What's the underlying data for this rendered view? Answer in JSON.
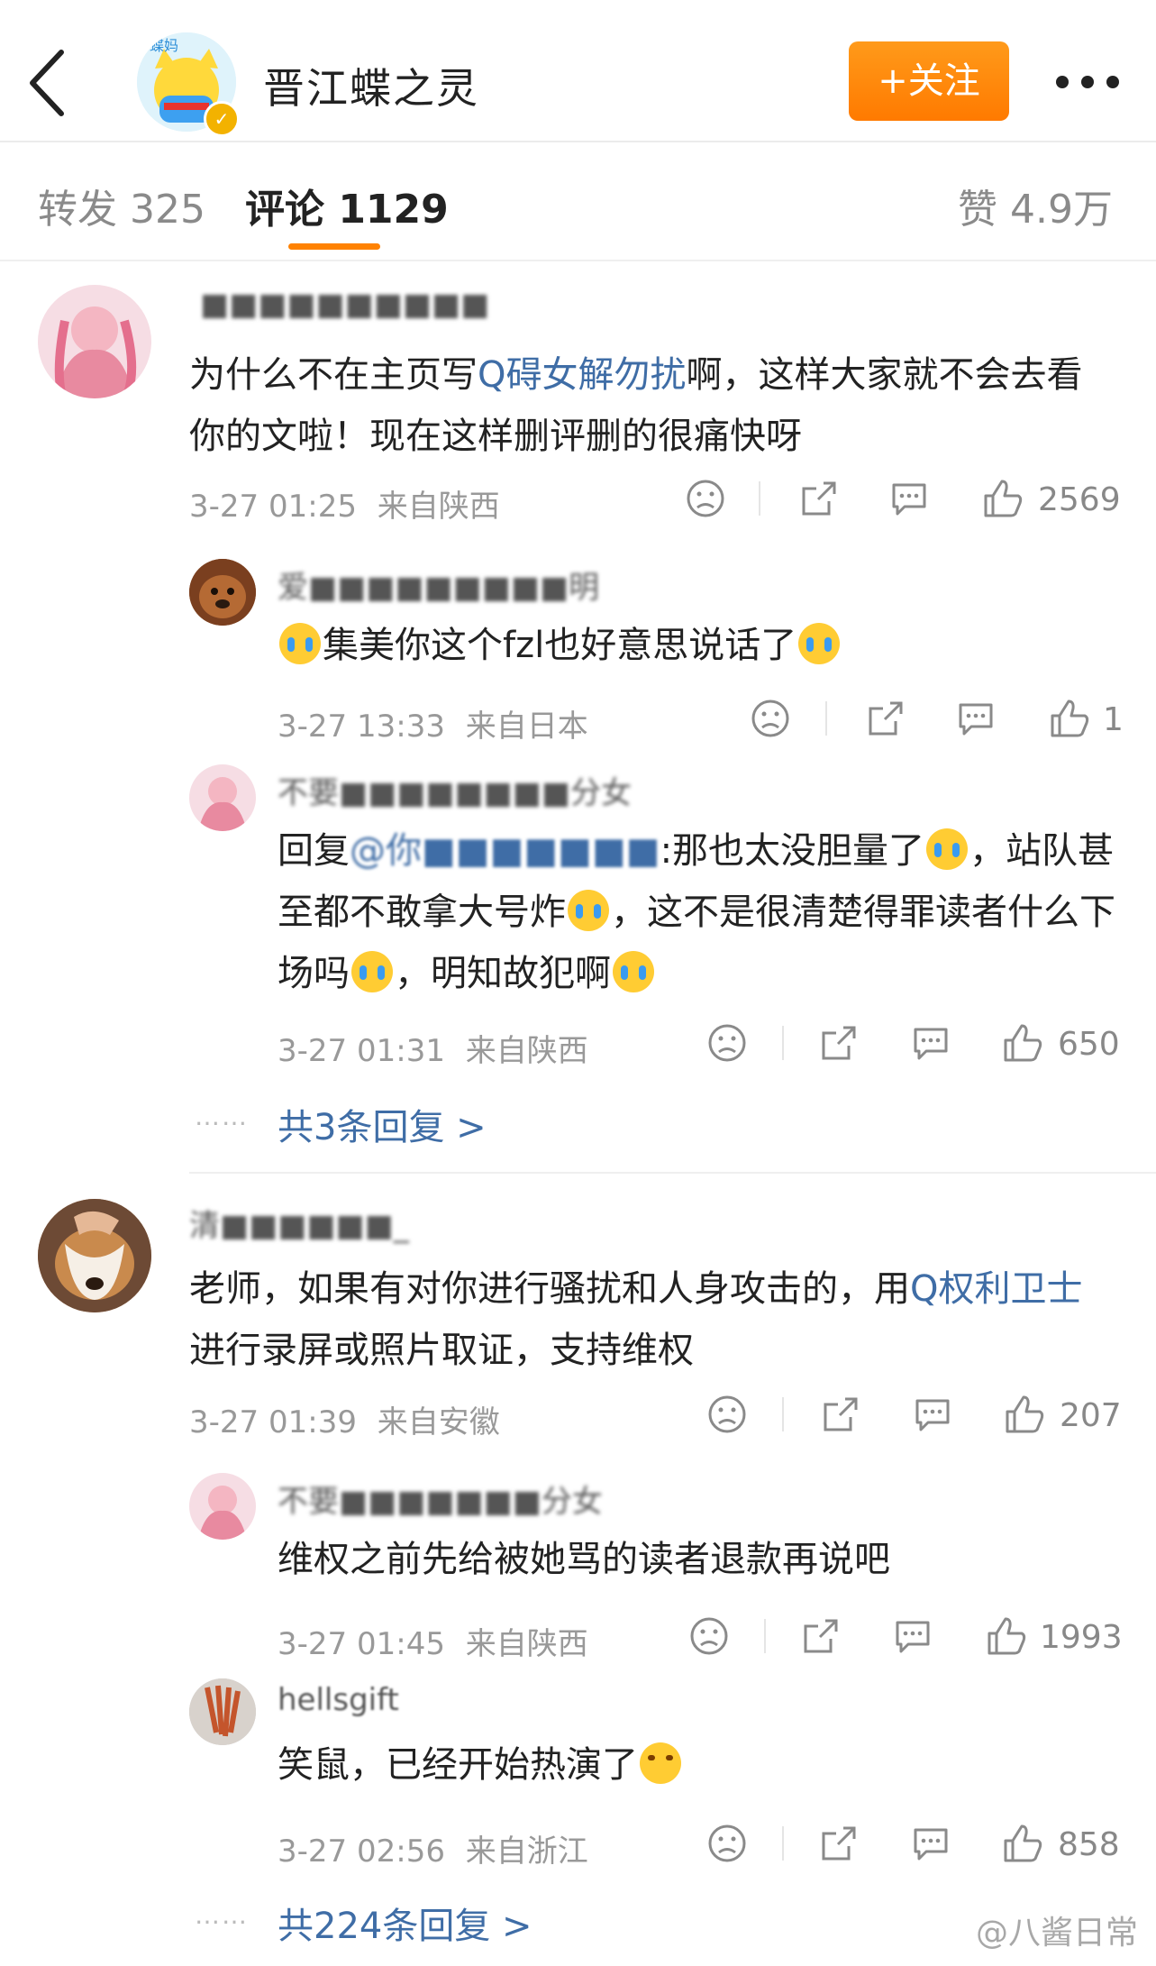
{
  "header": {
    "profile_name": "晋江蝶之灵",
    "follow_label": "+关注",
    "icons": {
      "back": "back-arrow-icon",
      "more": "more-dots-icon",
      "verified": "verified-badge-icon"
    }
  },
  "tabs": {
    "repost": "转发 325",
    "comment": "评论 1129",
    "like": "赞 4.9万"
  },
  "colors": {
    "accent": "#ff8200",
    "link": "#3f6da6",
    "meta": "#999999"
  },
  "comments": [
    {
      "user": "■■■■■■■■■■",
      "text_before": "为什么不在主页写",
      "link": "Q碍女解勿扰",
      "text_after": "啊，这样大家就不会去看你的文啦！现在这样删评删的很痛快呀",
      "time": "3-27 01:25",
      "loc": "来自陕西",
      "likes": "2569"
    },
    {
      "user": "爱■■■■■■■■■明",
      "text": "集美你这个fzl也好意思说话了",
      "time": "3-27 13:33",
      "loc": "来自日本",
      "likes": "1"
    },
    {
      "user": "不要■■■■■■■■分女",
      "reply_prefix": "回复",
      "reply_at": "@你■■■■■■■",
      "text_a": ":那也太没胆量了",
      "text_b": "，站队甚至都不敢拿大号炸",
      "text_c": "，这不是很清楚得罪读者什么下场吗",
      "text_d": "，明知故犯啊",
      "time": "3-27 01:31",
      "loc": "来自陕西",
      "likes": "650"
    },
    {
      "more_replies": "共3条回复 >"
    },
    {
      "user": "清■■■■■■_",
      "text_before": "老师，如果有对你进行骚扰和人身攻击的，用",
      "link": "Q权利卫士",
      "text_after": "进行录屏或照片取证，支持维权",
      "time": "3-27 01:39",
      "loc": "来自安徽",
      "likes": "207"
    },
    {
      "user": "不要■■■■■■■分女",
      "text": "维权之前先给被她骂的读者退款再说吧",
      "time": "3-27 01:45",
      "loc": "来自陕西",
      "likes": "1993"
    },
    {
      "user": "hellsgift",
      "text": "笑鼠，已经开始热演了",
      "time": "3-27 02:56",
      "loc": "来自浙江",
      "likes": "858"
    },
    {
      "more_replies": "共224条回复 >"
    }
  ],
  "ellipsis": "……",
  "watermark": "@八酱日常"
}
